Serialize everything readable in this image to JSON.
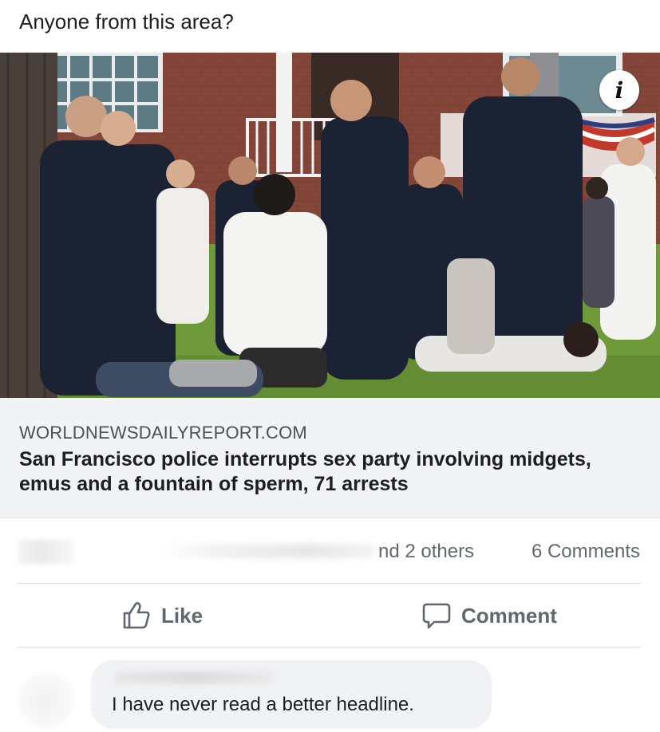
{
  "post": {
    "text": "Anyone from this area?"
  },
  "photo": {
    "description_icon": "info-icon",
    "info_label": "i"
  },
  "link_preview": {
    "domain": "WORLDNEWSDAILYREPORT.COM",
    "title": "San Francisco police interrupts sex party involving midgets, emus and a fountain of sperm, 71 arrests"
  },
  "stats": {
    "others": "nd 2 others",
    "comments": "6 Comments"
  },
  "actions": {
    "like_label": "Like",
    "comment_label": "Comment",
    "like_icon": "thumbs-up-icon",
    "comment_icon": "speech-bubble-icon"
  },
  "comment": {
    "text": "I have never read a better headline."
  },
  "colors": {
    "text_primary": "#1c1e21",
    "text_secondary": "#606770",
    "preview_bg": "#f2f3f5",
    "bubble_bg": "#f0f2f5",
    "divider": "#dadde1"
  }
}
